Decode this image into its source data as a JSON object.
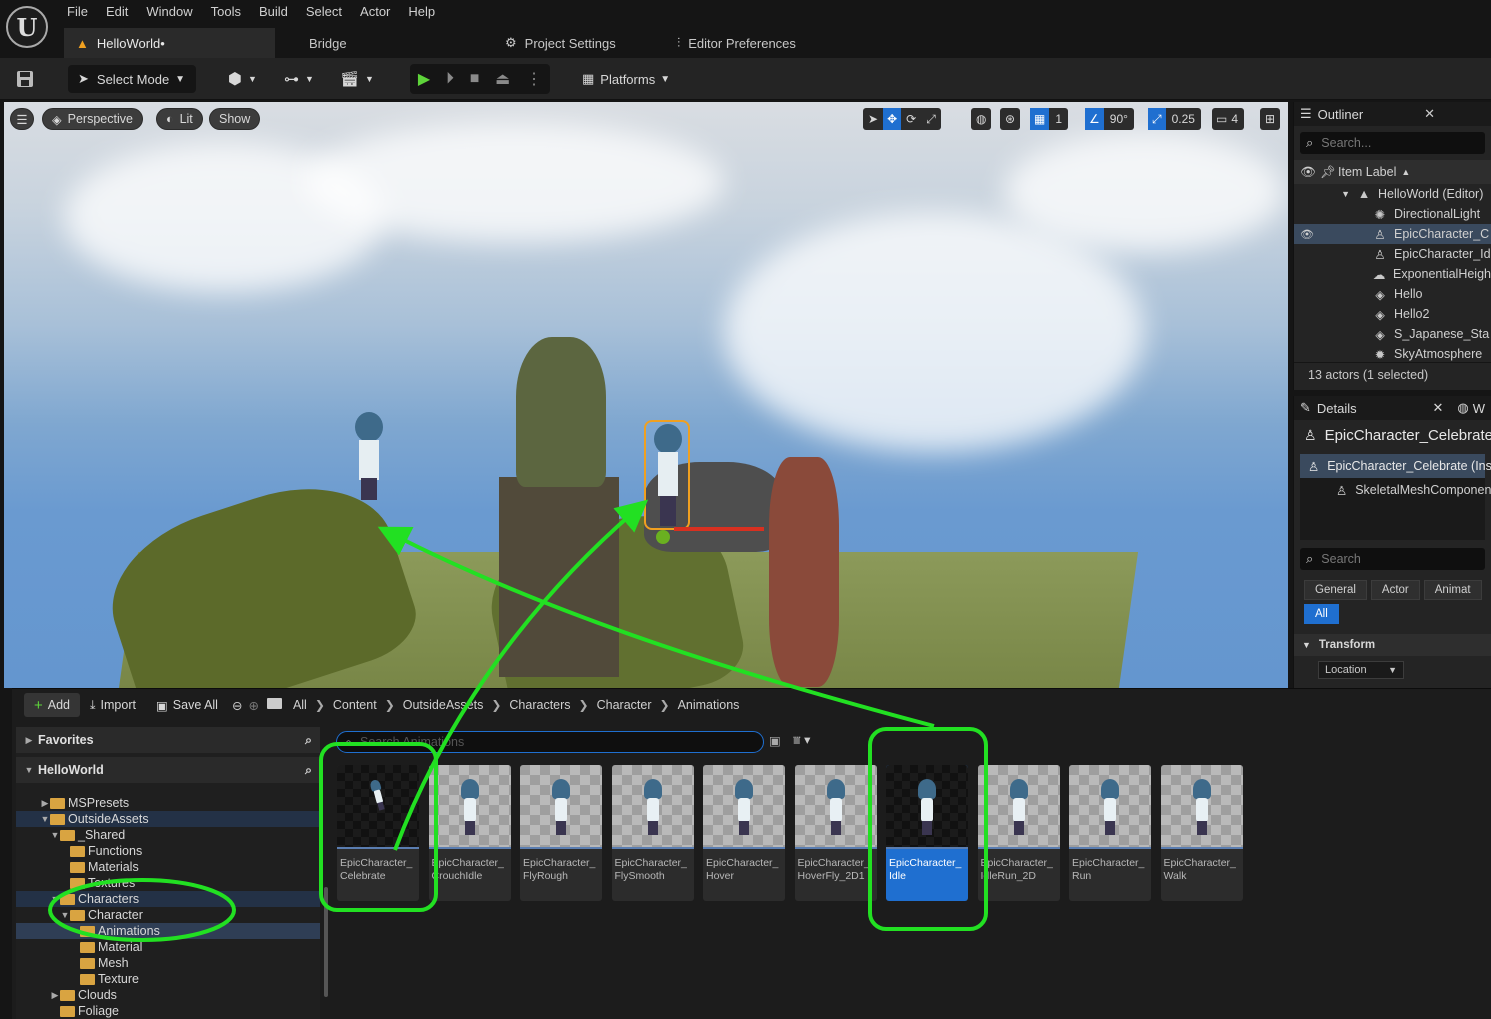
{
  "app": {
    "logo_text": "U",
    "menu": [
      "File",
      "Edit",
      "Window",
      "Tools",
      "Build",
      "Select",
      "Actor",
      "Help"
    ],
    "tabs": [
      {
        "label": "HelloWorld•",
        "icon": "level-icon"
      },
      {
        "label": "Bridge",
        "icon": ""
      },
      {
        "label": "Project Settings",
        "icon": "settings-gear-icon"
      },
      {
        "label": "Editor Preferences",
        "icon": "sliders-icon"
      }
    ]
  },
  "toolbar": {
    "select_mode": "Select Mode",
    "platforms": "Platforms"
  },
  "viewport": {
    "perspective": "Perspective",
    "lit": "Lit",
    "show": "Show",
    "grid_snap": "1",
    "rotation_snap": "90°",
    "scale_snap": "0.25",
    "camera_speed": "4"
  },
  "outliner": {
    "title": "Outliner",
    "search_placeholder": "Search...",
    "column": "Item Label",
    "items": [
      {
        "label": "HelloWorld (Editor)",
        "icon": "level-icon",
        "selected": false
      },
      {
        "label": "DirectionalLight",
        "icon": "sun-icon",
        "selected": false
      },
      {
        "label": "EpicCharacter_C",
        "icon": "skeleton-icon",
        "selected": true
      },
      {
        "label": "EpicCharacter_Id",
        "icon": "skeleton-icon",
        "selected": false
      },
      {
        "label": "ExponentialHeigh",
        "icon": "fog-icon",
        "selected": false
      },
      {
        "label": "Hello",
        "icon": "mesh-icon",
        "selected": false
      },
      {
        "label": "Hello2",
        "icon": "mesh-icon",
        "selected": false
      },
      {
        "label": "S_Japanese_Sta",
        "icon": "mesh-icon",
        "selected": false
      },
      {
        "label": "SkyAtmosphere",
        "icon": "sky-icon",
        "selected": false
      }
    ],
    "footer": "13 actors (1 selected)"
  },
  "details": {
    "title": "Details",
    "second_tab": "W",
    "actor_name": "EpicCharacter_Celebrate",
    "component_root": "EpicCharacter_Celebrate (Ins",
    "component_child": "SkeletalMeshComponen",
    "search_placeholder": "Search",
    "filters": [
      "General",
      "Actor",
      "Animat"
    ],
    "filter_all": "All",
    "section": "Transform",
    "location": "Location"
  },
  "content_browser": {
    "add": "Add",
    "import": "Import",
    "save_all": "Save All",
    "breadcrumb": [
      "All",
      "Content",
      "OutsideAssets",
      "Characters",
      "Character",
      "Animations"
    ],
    "search_placeholder": "Search Animations",
    "favorites": "Favorites",
    "project": "HelloWorld",
    "folders": [
      {
        "label": "MSPresets",
        "depth": 1,
        "expanded": false,
        "state": "normal"
      },
      {
        "label": "OutsideAssets",
        "depth": 1,
        "expanded": true,
        "state": "highlight"
      },
      {
        "label": "_Shared",
        "depth": 2,
        "expanded": true,
        "state": "normal"
      },
      {
        "label": "Functions",
        "depth": 3,
        "expanded": null,
        "state": "normal"
      },
      {
        "label": "Materials",
        "depth": 3,
        "expanded": null,
        "state": "normal"
      },
      {
        "label": "Textures",
        "depth": 3,
        "expanded": null,
        "state": "normal"
      },
      {
        "label": "Characters",
        "depth": 2,
        "expanded": true,
        "state": "highlight"
      },
      {
        "label": "Character",
        "depth": 3,
        "expanded": true,
        "state": "normal"
      },
      {
        "label": "Animations",
        "depth": 4,
        "expanded": null,
        "state": "selected"
      },
      {
        "label": "Material",
        "depth": 4,
        "expanded": null,
        "state": "normal"
      },
      {
        "label": "Mesh",
        "depth": 4,
        "expanded": null,
        "state": "normal"
      },
      {
        "label": "Texture",
        "depth": 4,
        "expanded": null,
        "state": "normal"
      },
      {
        "label": "Clouds",
        "depth": 2,
        "expanded": false,
        "state": "normal"
      },
      {
        "label": "Foliage",
        "depth": 2,
        "expanded": null,
        "state": "normal"
      }
    ],
    "assets": [
      {
        "line1": "EpicCharacter_",
        "line2": "Celebrate",
        "dark": true,
        "selected": false
      },
      {
        "line1": "EpicCharacter_",
        "line2": "CrouchIdle",
        "dark": false,
        "selected": false
      },
      {
        "line1": "EpicCharacter_",
        "line2": "FlyRough",
        "dark": false,
        "selected": false
      },
      {
        "line1": "EpicCharacter_",
        "line2": "FlySmooth",
        "dark": false,
        "selected": false
      },
      {
        "line1": "EpicCharacter_",
        "line2": "Hover",
        "dark": false,
        "selected": false
      },
      {
        "line1": "EpicCharacter_",
        "line2": "HoverFly_2D1",
        "dark": false,
        "selected": false
      },
      {
        "line1": "EpicCharacter_",
        "line2": "Idle",
        "dark": true,
        "selected": true
      },
      {
        "line1": "EpicCharacter_",
        "line2": "IdleRun_2D",
        "dark": false,
        "selected": false
      },
      {
        "line1": "EpicCharacter_",
        "line2": "Run",
        "dark": false,
        "selected": false
      },
      {
        "line1": "EpicCharacter_",
        "line2": "Walk",
        "dark": false,
        "selected": false
      }
    ]
  },
  "colors": {
    "accent": "#1f6fd0",
    "annotation": "#22e022",
    "folder": "#d9a441"
  }
}
